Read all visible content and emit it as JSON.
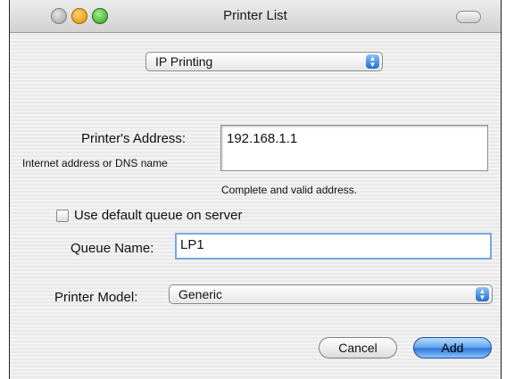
{
  "window": {
    "title": "Printer List"
  },
  "protocol_popup": {
    "value": "IP Printing"
  },
  "address": {
    "label": "Printer's Address:",
    "hint": "Internet address or DNS name",
    "value": "192.168.1.1",
    "status": "Complete and valid address."
  },
  "queue": {
    "default_checkbox_label": "Use default queue on server",
    "default_checked": false,
    "name_label": "Queue Name:",
    "name_value": "LP1"
  },
  "model": {
    "label": "Printer Model:",
    "value": "Generic"
  },
  "buttons": {
    "cancel": "Cancel",
    "add": "Add"
  }
}
